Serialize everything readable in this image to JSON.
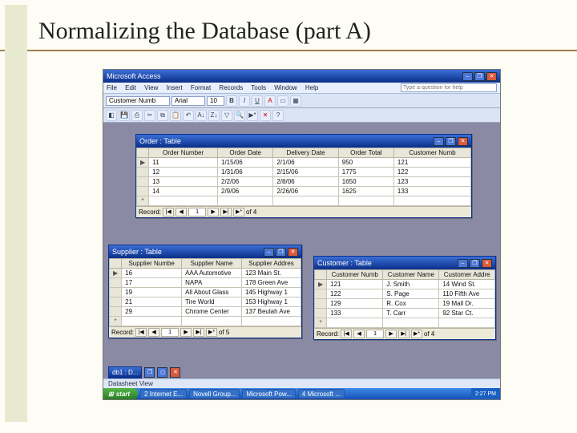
{
  "slide": {
    "title": "Normalizing the Database (part A)"
  },
  "app": {
    "title": "Microsoft Access",
    "help_placeholder": "Type a question for help",
    "menus": [
      "File",
      "Edit",
      "View",
      "Insert",
      "Format",
      "Records",
      "Tools",
      "Window",
      "Help"
    ],
    "font_selector": "Customer Numb",
    "font_name": "Arial",
    "font_size": "10",
    "minimized_window": "db1 : D...",
    "statusbar": "Datasheet View"
  },
  "windows": {
    "order": {
      "title": "Order : Table",
      "columns": [
        "Order Number",
        "Order Date",
        "Delivery Date",
        "Order Total",
        "Customer Numb"
      ],
      "rows": [
        [
          "11",
          "1/15/06",
          "2/1/06",
          "950",
          "121"
        ],
        [
          "12",
          "1/31/06",
          "2/15/06",
          "1775",
          "122"
        ],
        [
          "13",
          "2/2/06",
          "2/8/06",
          "1650",
          "123"
        ],
        [
          "14",
          "2/9/06",
          "2/26/06",
          "1625",
          "133"
        ]
      ],
      "nav": {
        "label": "Record:",
        "current": "1",
        "of": "of  4"
      }
    },
    "supplier": {
      "title": "Supplier : Table",
      "columns": [
        "Supplier Numbe",
        "Supplier Name",
        "Supplier Addres"
      ],
      "rows": [
        [
          "16",
          "AAA Automotive",
          "123 Main St."
        ],
        [
          "17",
          "NAPA",
          "178 Green Ave"
        ],
        [
          "19",
          "All About Glass",
          "145 Highway 1"
        ],
        [
          "21",
          "Tire World",
          "153 Highway 1"
        ],
        [
          "29",
          "Chrome Center",
          "137 Beulah Ave"
        ]
      ],
      "nav": {
        "label": "Record:",
        "current": "1",
        "of": "of  5"
      }
    },
    "customer": {
      "title": "Customer : Table",
      "columns": [
        "Customer Numb",
        "Customer Name",
        "Customer Addre"
      ],
      "rows": [
        [
          "121",
          "J. Smith",
          "14 Wind St."
        ],
        [
          "122",
          "S. Page",
          "110 Fifth Ave"
        ],
        [
          "129",
          "R. Cox",
          "19 Mall Dr."
        ],
        [
          "133",
          "T. Carr",
          "92 Star Ct."
        ]
      ],
      "nav": {
        "label": "Record:",
        "current": "1",
        "of": "of  4"
      }
    }
  },
  "taskbar": {
    "start": "start",
    "items": [
      "2 Internet E...",
      "Novell Group...",
      "Microsoft Pow...",
      "4 Microsoft ..."
    ],
    "clock": "2:27 PM"
  }
}
